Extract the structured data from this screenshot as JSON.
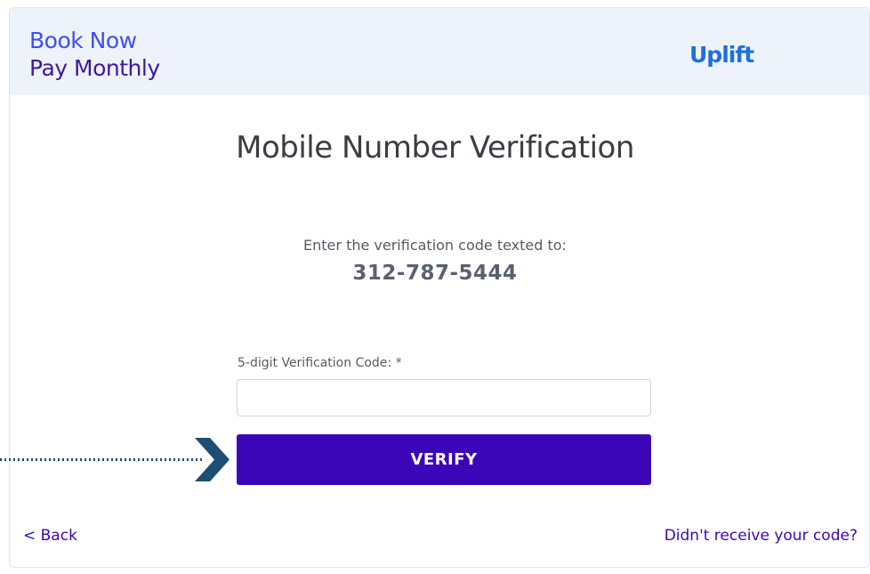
{
  "header": {
    "tagline_line1": "Book Now",
    "tagline_line2": "Pay Monthly",
    "logo_text": "Uplift"
  },
  "main": {
    "title": "Mobile Number Verification",
    "instruction": "Enter the verification code texted to:",
    "phone_number": "312-787-5444",
    "code_field": {
      "label": "5-digit Verification Code: *",
      "value": "",
      "placeholder": ""
    },
    "verify_button_label": "VERIFY"
  },
  "footer": {
    "back_link": "< Back",
    "resend_link": "Didn't receive your code?"
  },
  "icons": {
    "pointer": "chevron-right-icon"
  },
  "colors": {
    "header_bg": "#eef3fb",
    "brand_blue": "#3d4ff7",
    "brand_purple": "#3b06b7",
    "logo_blue": "#1e6fe0",
    "arrow_navy": "#1d4f73"
  }
}
